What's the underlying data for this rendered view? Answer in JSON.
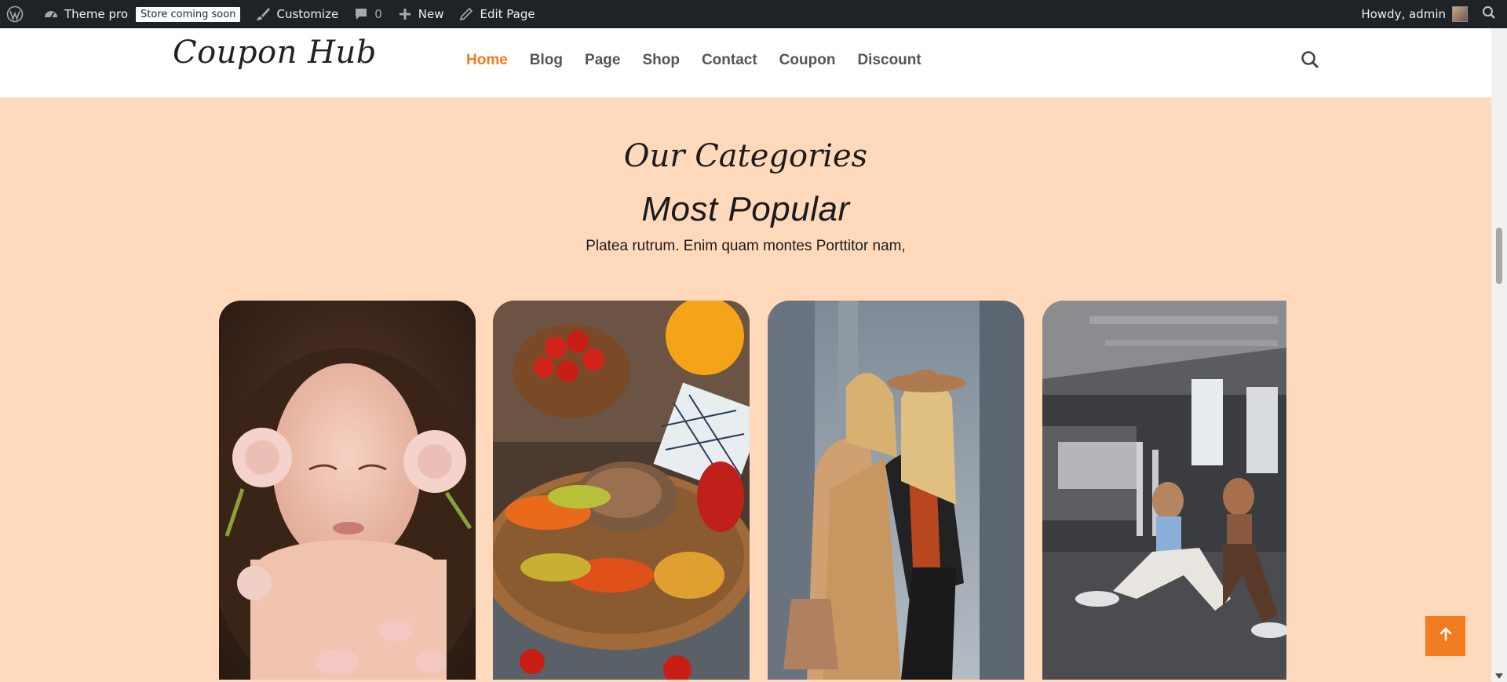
{
  "adminbar": {
    "site_name": "Theme pro",
    "badge": "Store coming soon",
    "customize": "Customize",
    "comments_count": "0",
    "new": "New",
    "edit_page": "Edit Page",
    "howdy": "Howdy, admin"
  },
  "header": {
    "logo": "Coupon Hub",
    "nav": [
      {
        "label": "Home",
        "active": true
      },
      {
        "label": "Blog"
      },
      {
        "label": "Page"
      },
      {
        "label": "Shop"
      },
      {
        "label": "Contact"
      },
      {
        "label": "Coupon"
      },
      {
        "label": "Discount"
      }
    ]
  },
  "section": {
    "script_title": "Our Categories",
    "title": "Most Popular",
    "subtitle": "Platea rutrum. Enim quam montes Porttitor nam,"
  },
  "cards": [
    {
      "name": "beauty",
      "icon": "beauty-image"
    },
    {
      "name": "food",
      "icon": "food-image"
    },
    {
      "name": "fashion",
      "icon": "fashion-image"
    },
    {
      "name": "fitness",
      "icon": "fitness-image"
    }
  ],
  "colors": {
    "accent": "#f47c20",
    "page_bg": "#ffd9bc",
    "admin_bar": "#1d2327"
  }
}
